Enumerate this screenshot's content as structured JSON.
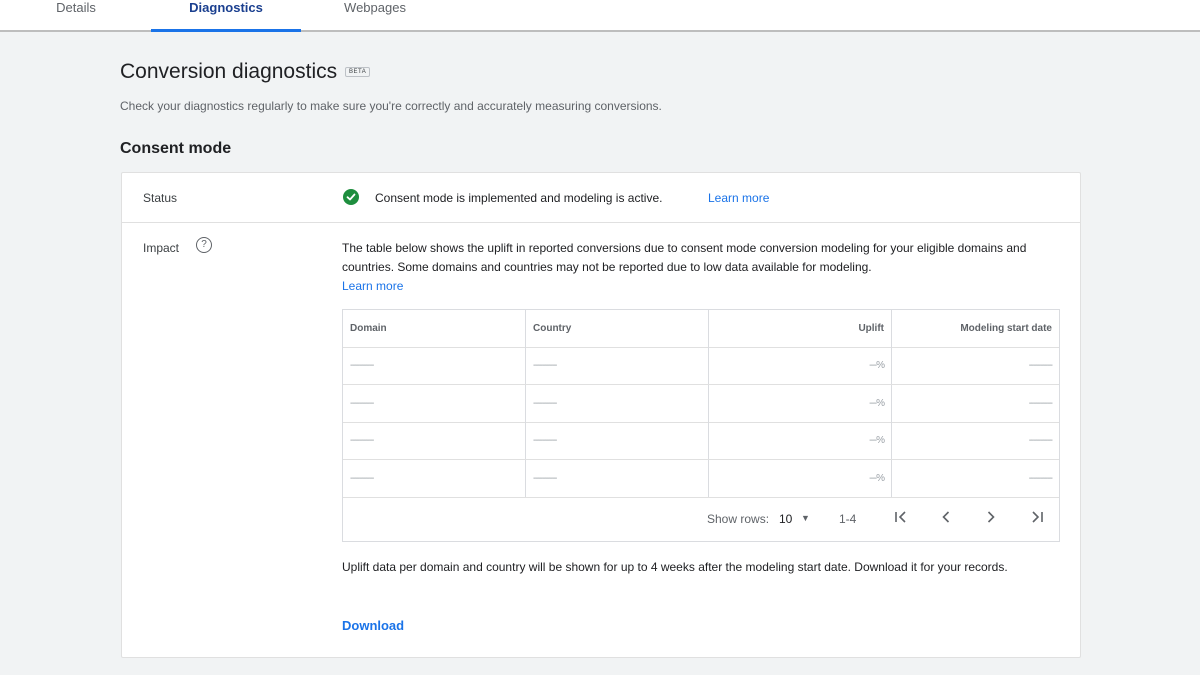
{
  "tabs": [
    {
      "label": "Details"
    },
    {
      "label": "Diagnostics"
    },
    {
      "label": "Webpages"
    }
  ],
  "page": {
    "title": "Conversion diagnostics",
    "badge": "BETA",
    "subtitle": "Check your diagnostics regularly to make sure you're correctly and accurately measuring conversions."
  },
  "section": {
    "title": "Consent mode"
  },
  "status": {
    "label": "Status",
    "text": "Consent mode is implemented and modeling is active.",
    "link": "Learn more",
    "icon": "check-circle-icon",
    "color": "#1e8e3e"
  },
  "impact": {
    "label": "Impact",
    "help_icon": "?",
    "description": "The table below shows the uplift in reported conversions due to consent mode conversion modeling for your eligible domains and countries. Some domains and countries may not be reported due to low data available for modeling.",
    "link": "Learn more"
  },
  "table": {
    "headers": [
      "Domain",
      "Country",
      "Uplift",
      "Modeling start date"
    ],
    "rows": [
      [
        "----------",
        "----------",
        "---%",
        "----------"
      ],
      [
        "----------",
        "----------",
        "---%",
        "----------"
      ],
      [
        "----------",
        "----------",
        "---%",
        "----------"
      ],
      [
        "----------",
        "----------",
        "---%",
        "----------"
      ]
    ]
  },
  "pager": {
    "show_rows_label": "Show rows:",
    "rows_value": "10",
    "range": "1-4"
  },
  "footer": {
    "text": "Uplift data per domain and country will be shown for up to 4 weeks after the modeling start date. Download it for your records.",
    "download": "Download"
  },
  "colors": {
    "accent": "#1a73e8",
    "success": "#1e8e3e"
  }
}
